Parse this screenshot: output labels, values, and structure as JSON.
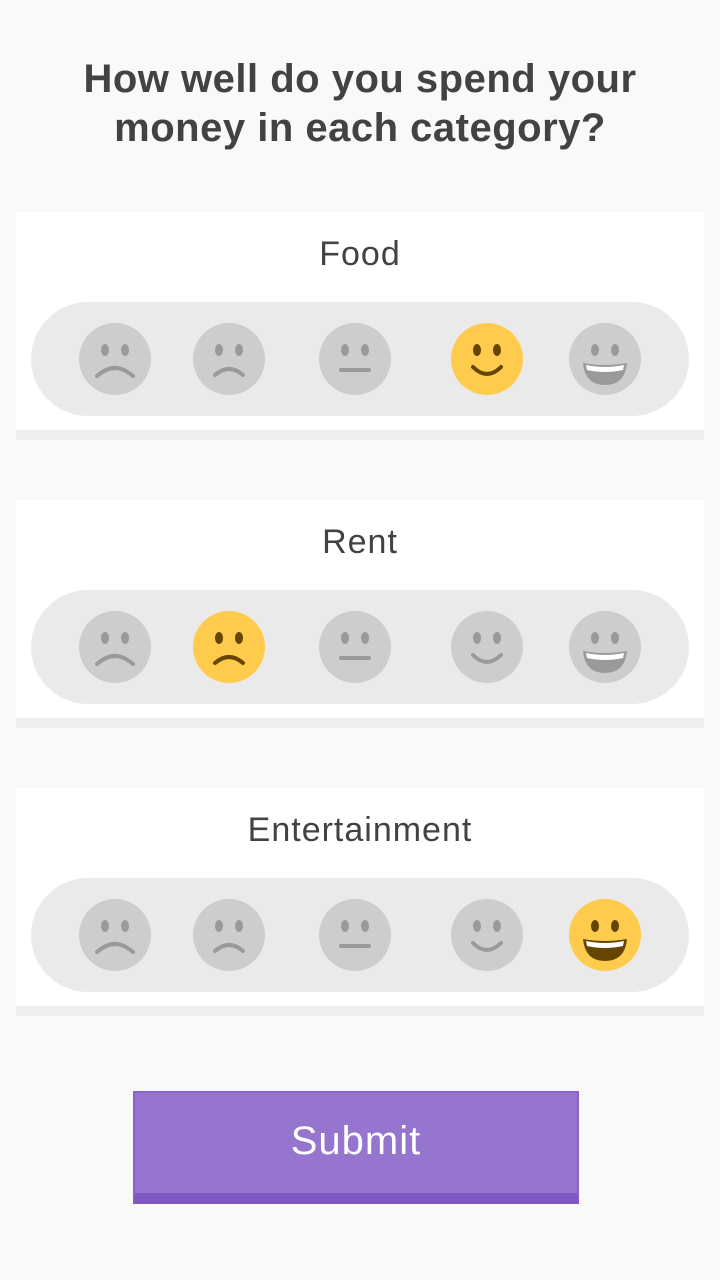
{
  "question": "How well do you spend your money in each category?",
  "rating_scale": [
    "very-sad",
    "sad",
    "neutral",
    "happy",
    "very-happy"
  ],
  "categories": [
    {
      "label": "Food",
      "selected_index": 3
    },
    {
      "label": "Rent",
      "selected_index": 1
    },
    {
      "label": "Entertainment",
      "selected_index": 4
    }
  ],
  "colors": {
    "selected_face": "#ffcb4c",
    "unselected_face": "#cdcdcd",
    "submit_button": "#9575cd"
  },
  "submit_label": "Submit"
}
